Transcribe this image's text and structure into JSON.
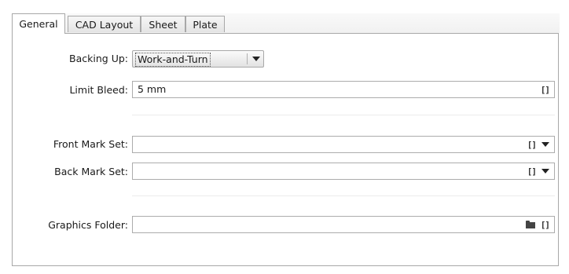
{
  "tabs": [
    {
      "label": "General",
      "active": true
    },
    {
      "label": "CAD Layout",
      "active": false
    },
    {
      "label": "Sheet",
      "active": false
    },
    {
      "label": "Plate",
      "active": false
    }
  ],
  "form": {
    "backing_up": {
      "label": "Backing Up:",
      "value": "Work-and-Turn"
    },
    "limit_bleed": {
      "label": "Limit Bleed:",
      "value": "5 mm"
    },
    "front_mark_set": {
      "label": "Front Mark Set:",
      "value": ""
    },
    "back_mark_set": {
      "label": "Back Mark Set:",
      "value": ""
    },
    "graphics_folder": {
      "label": "Graphics Folder:",
      "value": ""
    }
  },
  "icon_glyphs": {
    "bracket": "[]"
  }
}
